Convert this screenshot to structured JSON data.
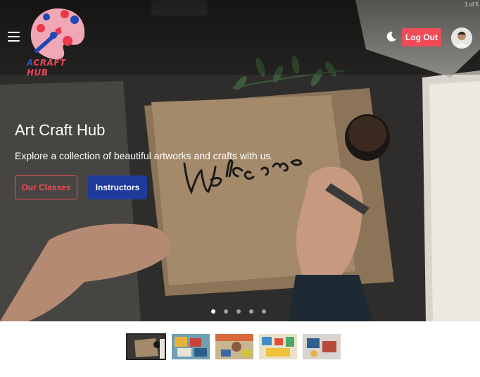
{
  "header": {
    "menu_icon": "hamburger-menu-icon",
    "logo_icon": "paint-palette-icon",
    "logo_text_first": "A",
    "logo_text_rest": "CRAFT HUB",
    "theme_icon": "moon-icon",
    "logout_label": "Log Out",
    "avatar_icon": "user-avatar"
  },
  "slider": {
    "counter": "1 of 5",
    "title": "Art Craft Hub",
    "subtitle": "Explore a collection of beautiful artworks and crafts with us.",
    "primary_button": "Our Classes",
    "secondary_button": "Instructors",
    "slide_count": 5,
    "active_slide": 1
  },
  "colors": {
    "accent_red": "#ef4c57",
    "accent_blue": "#1e3a9a"
  }
}
